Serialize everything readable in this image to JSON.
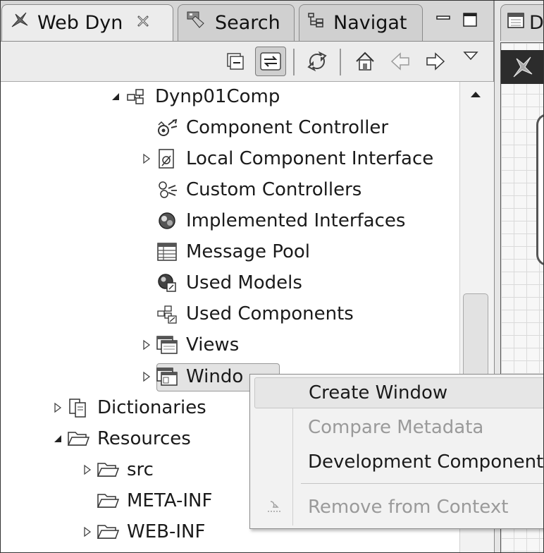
{
  "tabs": [
    {
      "label": "Web Dyn",
      "icon": "web-dynpro-explorer-icon",
      "active": true,
      "closable": true
    },
    {
      "label": "Search",
      "icon": "search-flashlight-icon",
      "active": false
    },
    {
      "label": "Navigat",
      "icon": "navigator-icon",
      "active": false
    }
  ],
  "editor_tab": {
    "label": "D",
    "icon": "editor-diagram-icon"
  },
  "toolbar": {
    "buttons": [
      "collapse-all-icon",
      "link-with-editor-icon",
      "sync-icon",
      "home-icon",
      "back-icon",
      "forward-icon",
      "view-menu-icon"
    ]
  },
  "tree": {
    "component": "Dynp01Comp",
    "items": [
      {
        "label": "Component Controller",
        "icon": "controller-icon"
      },
      {
        "label": "Local Component Interface",
        "icon": "interface-icon",
        "expandable": true
      },
      {
        "label": "Custom Controllers",
        "icon": "custom-controllers-icon"
      },
      {
        "label": "Implemented Interfaces",
        "icon": "implemented-interfaces-icon"
      },
      {
        "label": "Message Pool",
        "icon": "message-pool-icon"
      },
      {
        "label": "Used Models",
        "icon": "used-models-icon"
      },
      {
        "label": "Used Components",
        "icon": "used-components-icon"
      },
      {
        "label": "Views",
        "icon": "views-folder-icon",
        "expandable": true
      },
      {
        "label": "Windo",
        "icon": "windows-folder-icon",
        "expandable": true,
        "selected": true
      }
    ],
    "roots": [
      {
        "label": "Dictionaries",
        "icon": "dictionaries-icon",
        "expanded": false
      },
      {
        "label": "Resources",
        "icon": "folder-open-icon",
        "expanded": true
      }
    ],
    "resources": [
      {
        "label": "src",
        "expandable": true
      },
      {
        "label": "META-INF",
        "expandable": false
      },
      {
        "label": "WEB-INF",
        "expandable": true
      }
    ]
  },
  "context_menu": {
    "items": [
      {
        "label": "Create Window",
        "enabled": true,
        "highlighted": true
      },
      {
        "label": "Compare Metadata",
        "enabled": false
      },
      {
        "label": "Development Component",
        "enabled": true
      },
      {
        "label": "Remove from Context",
        "enabled": false,
        "icon": "remove-from-context-icon"
      }
    ]
  }
}
